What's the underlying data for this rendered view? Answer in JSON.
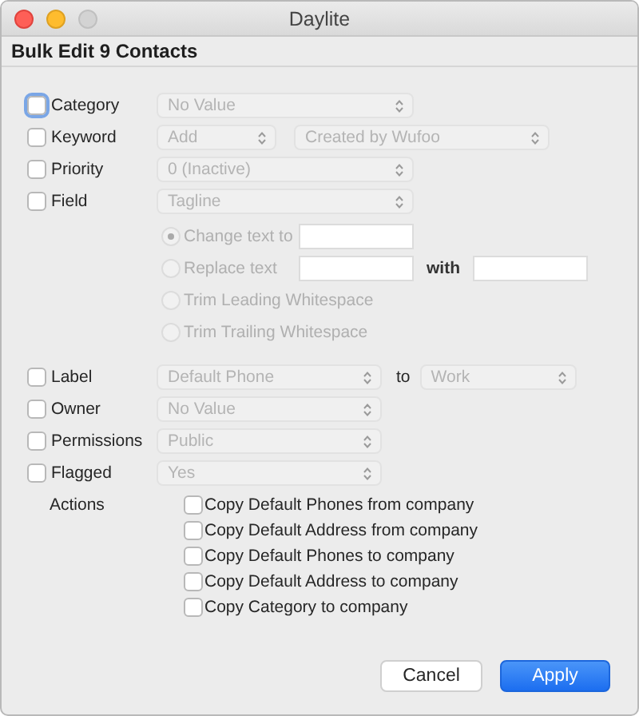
{
  "window": {
    "title": "Daylite"
  },
  "heading": "Bulk Edit 9 Contacts",
  "fields": [
    {
      "label": "Category",
      "checked": false,
      "focused": true,
      "controls": [
        {
          "kind": "popup",
          "value": "No Value",
          "disabled": true
        }
      ]
    },
    {
      "label": "Keyword",
      "checked": false,
      "focused": false,
      "controls": [
        {
          "kind": "popup",
          "value": "Add",
          "disabled": true
        },
        {
          "kind": "popup",
          "value": "Created by Wufoo",
          "disabled": true
        }
      ]
    },
    {
      "label": "Priority",
      "checked": false,
      "focused": false,
      "controls": [
        {
          "kind": "popup",
          "value": "0 (Inactive)",
          "disabled": true
        }
      ]
    },
    {
      "label": "Field",
      "checked": false,
      "focused": false,
      "controls": [
        {
          "kind": "popup",
          "value": "Tagline",
          "disabled": true
        }
      ],
      "options": [
        {
          "label": "Change text to",
          "selected": true,
          "disabled": true,
          "inputs": [
            {
              "kind": "input"
            }
          ]
        },
        {
          "label": "Replace text",
          "selected": false,
          "disabled": true,
          "inputs": [
            {
              "kind": "input"
            },
            {
              "kind": "text",
              "text": "with"
            },
            {
              "kind": "input"
            }
          ]
        },
        {
          "label": "Trim Leading Whitespace",
          "selected": false,
          "disabled": true
        },
        {
          "label": "Trim Trailing Whitespace",
          "selected": false,
          "disabled": true
        }
      ]
    },
    {
      "label": "Label",
      "checked": false,
      "focused": false,
      "controls": [
        {
          "kind": "popup",
          "value": "Default Phone",
          "disabled": true
        },
        {
          "kind": "text",
          "text": "to"
        },
        {
          "kind": "popup",
          "value": "Work",
          "disabled": true
        }
      ]
    },
    {
      "label": "Owner",
      "checked": false,
      "focused": false,
      "controls": [
        {
          "kind": "popup",
          "value": "No Value",
          "disabled": true
        }
      ]
    },
    {
      "label": "Permissions",
      "checked": false,
      "focused": false,
      "controls": [
        {
          "kind": "popup",
          "value": "Public",
          "disabled": true
        }
      ]
    },
    {
      "label": "Flagged",
      "checked": false,
      "focused": false,
      "controls": [
        {
          "kind": "popup",
          "value": "Yes",
          "disabled": true
        }
      ]
    }
  ],
  "actions": {
    "label": "Actions",
    "options": [
      {
        "label": "Copy Default Phones from company",
        "checked": false
      },
      {
        "label": "Copy Default Address from company",
        "checked": false
      },
      {
        "label": "Copy Default Phones to company",
        "checked": false
      },
      {
        "label": "Copy Default Address to company",
        "checked": false
      },
      {
        "label": "Copy Category to company",
        "checked": false
      }
    ]
  },
  "buttons": [
    {
      "label": "Cancel",
      "default": false
    },
    {
      "label": "Apply",
      "default": true
    }
  ]
}
